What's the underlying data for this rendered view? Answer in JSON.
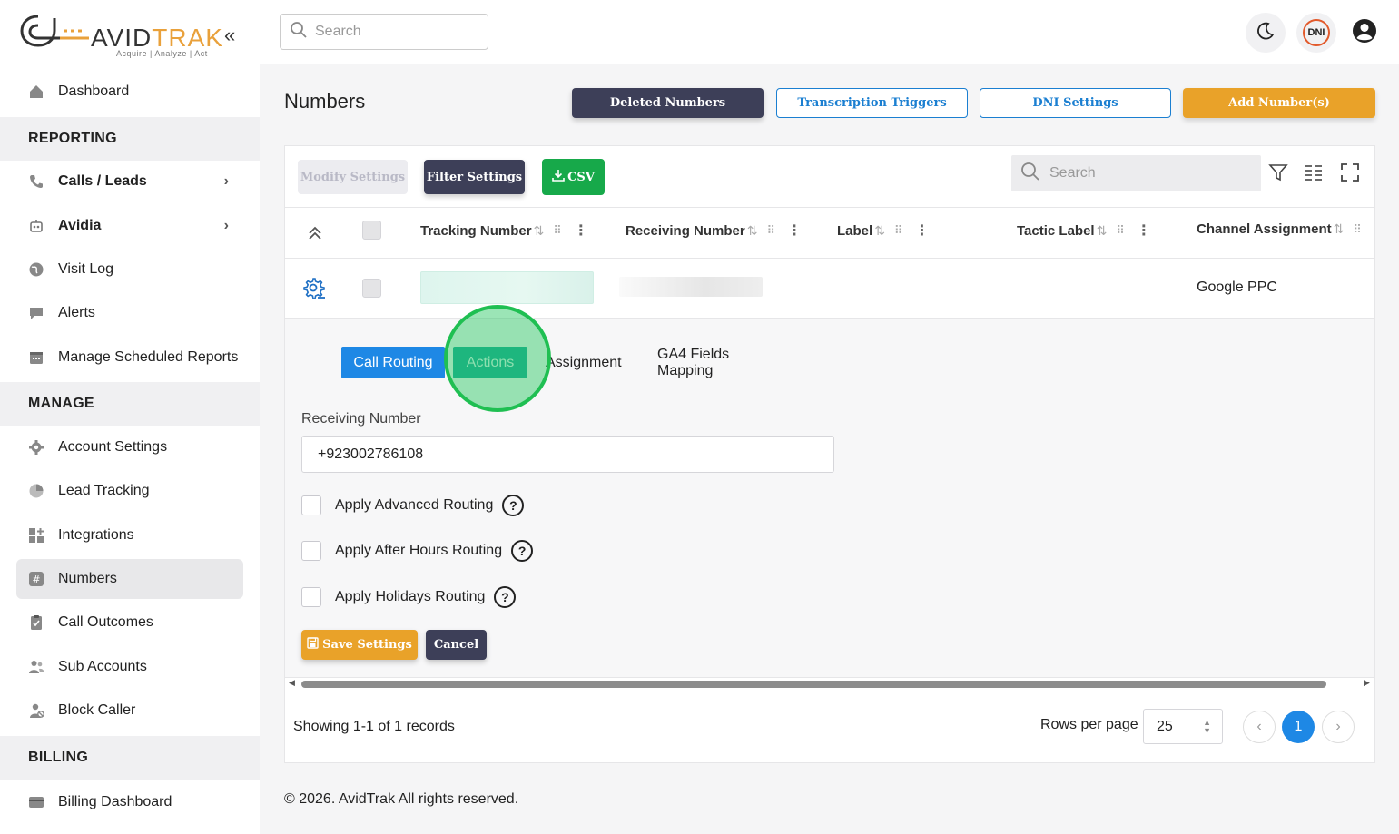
{
  "brand": {
    "name_part1": "AVID",
    "name_part2": "TRAK",
    "tagline": "Acquire   |   Analyze   |   Act"
  },
  "topbar": {
    "search_placeholder": "Search",
    "dni_badge": "DNI"
  },
  "sidebar": {
    "items": [
      {
        "label": "Dashboard",
        "icon": "home-icon"
      },
      {
        "section": "REPORTING"
      },
      {
        "label": "Calls / Leads",
        "icon": "phone-icon"
      },
      {
        "label": "Avidia",
        "icon": "robot-icon"
      },
      {
        "label": "Visit Log",
        "icon": "globe-icon"
      },
      {
        "label": "Alerts",
        "icon": "chat-icon"
      },
      {
        "label": "Manage Scheduled Reports",
        "icon": "calendar-icon"
      },
      {
        "section": "MANAGE"
      },
      {
        "label": "Account Settings",
        "icon": "gear-icon"
      },
      {
        "label": "Lead Tracking",
        "icon": "pie-chart-icon"
      },
      {
        "label": "Integrations",
        "icon": "grid-plus-icon"
      },
      {
        "label": "Numbers",
        "icon": "hash-icon"
      },
      {
        "label": "Call Outcomes",
        "icon": "clipboard-check-icon"
      },
      {
        "label": "Sub Accounts",
        "icon": "users-icon"
      },
      {
        "label": "Block Caller",
        "icon": "user-block-icon"
      },
      {
        "section": "BILLING"
      },
      {
        "label": "Billing Dashboard",
        "icon": "card-icon"
      }
    ]
  },
  "page": {
    "title": "Numbers",
    "buttons": {
      "deleted": "Deleted Numbers",
      "triggers": "Transcription Triggers",
      "dni": "DNI Settings",
      "add": "Add Number(s)"
    }
  },
  "grid": {
    "toolbar": {
      "modify": "Modify Settings",
      "filter": "Filter Settings",
      "csv": "CSV",
      "search_placeholder": "Search"
    },
    "columns": [
      "Tracking Number",
      "Receiving Number",
      "Label",
      "Tactic Label",
      "Channel Assignment"
    ],
    "row": {
      "channel_assignment": "Google PPC"
    },
    "detail": {
      "tabs": [
        "Call Routing",
        "Actions",
        "Assignment",
        "GA4 Fields Mapping"
      ],
      "receiving_label": "Receiving Number",
      "receiving_value": "+923002786108",
      "options": [
        "Apply Advanced Routing",
        "Apply After Hours Routing",
        "Apply Holidays Routing"
      ],
      "save": "Save Settings",
      "cancel": "Cancel"
    },
    "footer": {
      "showing": "Showing 1-1 of 1 records",
      "rows_per_page_label": "Rows per page",
      "rows_per_page": "25",
      "current_page": "1"
    }
  },
  "copyright": "© 2026. AvidTrak All rights reserved.",
  "colors": {
    "dark": "#3d3f58",
    "accent_blue": "#1e88e5",
    "orange": "#e9a229",
    "green": "#17a94a",
    "teal": "#1da99a"
  }
}
